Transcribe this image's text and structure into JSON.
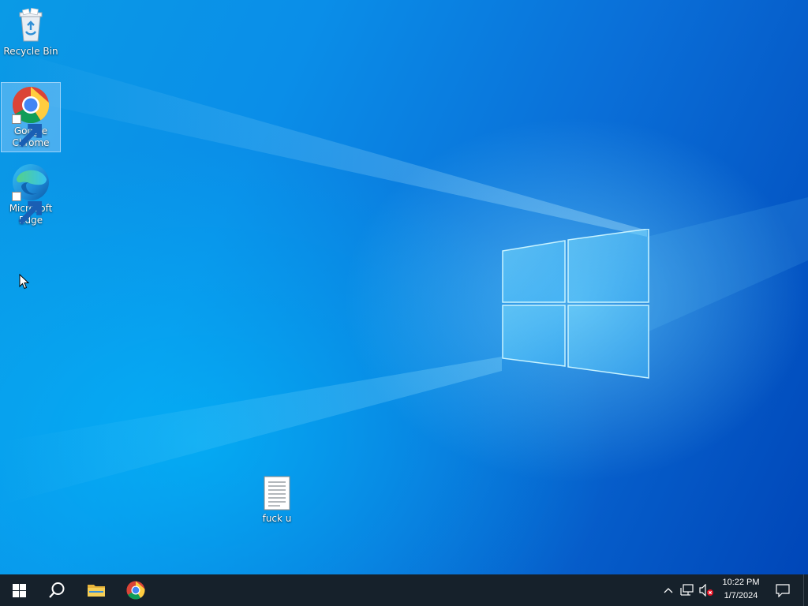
{
  "desktop": {
    "icons": [
      {
        "label": "Recycle Bin",
        "icon": "recycle-bin-icon"
      },
      {
        "label_line1": "Google",
        "label_line2": "Chrome",
        "icon": "chrome-icon",
        "selected": true
      },
      {
        "label_line1": "Microsoft",
        "label_line2": "Edge",
        "icon": "edge-icon"
      },
      {
        "label": "fuck u",
        "icon": "text-document-icon"
      }
    ]
  },
  "taskbar": {
    "start": "windows-start-icon",
    "search": "search-icon",
    "pinned": [
      "file-explorer-icon",
      "chrome-icon"
    ],
    "tray": {
      "icons": [
        "chevron-up-icon",
        "network-icon",
        "volume-muted-icon"
      ],
      "time": "10:22 PM",
      "date": "1/7/2024",
      "notification": "action-center-icon"
    }
  },
  "colors": {
    "taskbar_bg": "#16212b",
    "wallpaper_accent": "#0a8ee8"
  }
}
